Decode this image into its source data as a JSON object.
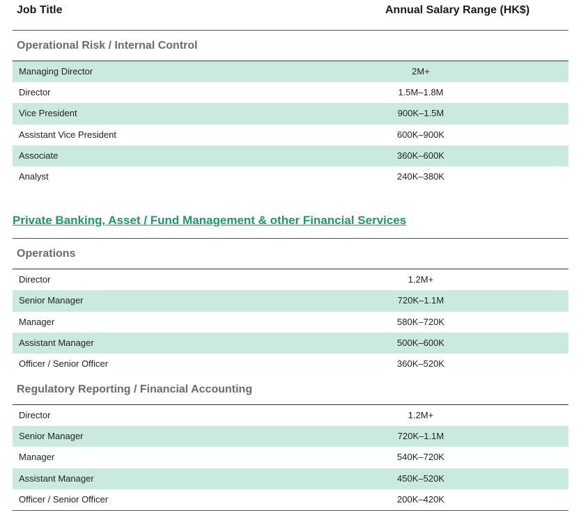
{
  "header": {
    "job_title": "Job Title",
    "salary_range": "Annual Salary Range (HK$)"
  },
  "groups": [
    {
      "title": "Operational Risk / Internal Control",
      "rows": [
        {
          "job": "Managing Director",
          "salary": "2M+"
        },
        {
          "job": "Director",
          "salary": "1.5M–1.8M"
        },
        {
          "job": "Vice President",
          "salary": "900K–1.5M"
        },
        {
          "job": "Assistant Vice President",
          "salary": "600K–900K"
        },
        {
          "job": "Associate",
          "salary": "360K–600K"
        },
        {
          "job": "Analyst",
          "salary": "240K–380K"
        }
      ]
    },
    {
      "section": "Private Banking, Asset / Fund Management & other Financial Services"
    },
    {
      "title": "Operations",
      "rows": [
        {
          "job": "Director",
          "salary": "1.2M+"
        },
        {
          "job": "Senior Manager",
          "salary": "720K–1.1M"
        },
        {
          "job": "Manager",
          "salary": "580K–720K"
        },
        {
          "job": "Assistant Manager",
          "salary": "500K–600K"
        },
        {
          "job": "Officer / Senior Officer",
          "salary": "360K–520K"
        }
      ]
    },
    {
      "title": "Regulatory Reporting / Financial Accounting",
      "rows": [
        {
          "job": "Director",
          "salary": "1.2M+"
        },
        {
          "job": "Senior Manager",
          "salary": "720K–1.1M"
        },
        {
          "job": "Manager",
          "salary": "540K–720K"
        },
        {
          "job": "Assistant Manager",
          "salary": "450K–520K"
        },
        {
          "job": "Officer / Senior Officer",
          "salary": "200K–420K"
        }
      ]
    }
  ]
}
